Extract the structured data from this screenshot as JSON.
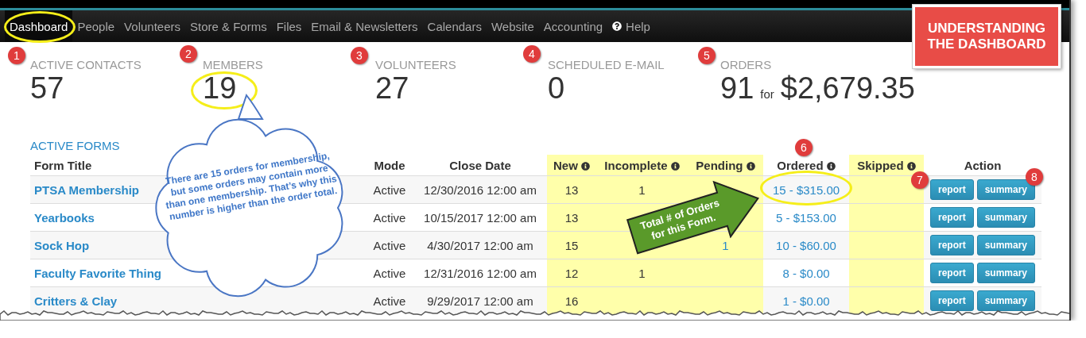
{
  "nav": {
    "items": [
      {
        "label": "Dashboard",
        "kind": "link",
        "selected": true
      },
      {
        "label": "People",
        "kind": "link",
        "selected": false
      },
      {
        "label": "Volunteers",
        "kind": "link",
        "selected": false
      },
      {
        "label": "Store & Forms",
        "kind": "link",
        "selected": false
      },
      {
        "label": "Files",
        "kind": "link",
        "selected": false
      },
      {
        "label": "Email & Newsletters",
        "kind": "link",
        "selected": false
      },
      {
        "label": "Calendars",
        "kind": "link",
        "selected": false
      },
      {
        "label": "Website",
        "kind": "link",
        "selected": false
      },
      {
        "label": "Accounting",
        "kind": "link",
        "selected": false
      },
      {
        "label": "Help",
        "kind": "help",
        "selected": false
      }
    ]
  },
  "stats": [
    {
      "label": "ACTIVE CONTACTS",
      "value": "57"
    },
    {
      "label": "MEMBERS",
      "value": "19"
    },
    {
      "label": "VOLUNTEERS",
      "value": "27"
    },
    {
      "label": "SCHEDULED E-MAIL",
      "value": "0"
    },
    {
      "label": "ORDERS",
      "value": "91",
      "joiner": "for",
      "amount": "$2,679.35"
    }
  ],
  "section_title": "ACTIVE FORMS",
  "table": {
    "columns": [
      {
        "label": "Form Title",
        "info": false,
        "highlighted": false
      },
      {
        "label": "Mode",
        "info": false,
        "highlighted": false
      },
      {
        "label": "Close Date",
        "info": false,
        "highlighted": false
      },
      {
        "label": "New",
        "info": true,
        "highlighted": true
      },
      {
        "label": "Incomplete",
        "info": true,
        "highlighted": true
      },
      {
        "label": "Pending",
        "info": true,
        "highlighted": true
      },
      {
        "label": "Ordered",
        "info": true,
        "highlighted": false
      },
      {
        "label": "Skipped",
        "info": true,
        "highlighted": true
      },
      {
        "label": "Action",
        "info": false,
        "highlighted": false
      }
    ],
    "rows": [
      {
        "title": "PTSA Membership",
        "mode": "Active",
        "close_date": "12/30/2016 12:00 am",
        "new": "13",
        "incomplete": "1",
        "ordered": "15 - $315.00",
        "actions": [
          "report",
          "summary"
        ]
      },
      {
        "title": "Yearbooks",
        "mode": "Active",
        "close_date": "10/15/2017 12:00 am",
        "new": "13",
        "ordered": "5 - $153.00",
        "actions": [
          "report",
          "summary"
        ]
      },
      {
        "title": "Sock Hop",
        "mode": "Active",
        "close_date": "4/30/2017 12:00 am",
        "new": "15",
        "pending": "1",
        "ordered": "10 - $60.00",
        "actions": [
          "report",
          "summary"
        ]
      },
      {
        "title": "Faculty Favorite Thing",
        "mode": "Active",
        "close_date": "12/31/2016 12:00 am",
        "new": "12",
        "incomplete": "1",
        "ordered": "8 - $0.00",
        "actions": [
          "report",
          "summary"
        ]
      },
      {
        "title": "Critters & Clay",
        "mode": "Active",
        "close_date": "9/29/2017 12:00 am",
        "new": "16",
        "ordered": "1 - $0.00",
        "actions": [
          "report",
          "summary"
        ]
      }
    ]
  },
  "annotations": {
    "title_box": "UNDERSTANDING THE DASHBOARD",
    "markers": [
      "1",
      "2",
      "3",
      "4",
      "5",
      "6",
      "7",
      "8"
    ],
    "callout": "There are 15 orders for membership, but some orders may contain more than one membership.  That’s why this number is higher than the order total.",
    "arrow": "Total # of Orders for this Form."
  }
}
